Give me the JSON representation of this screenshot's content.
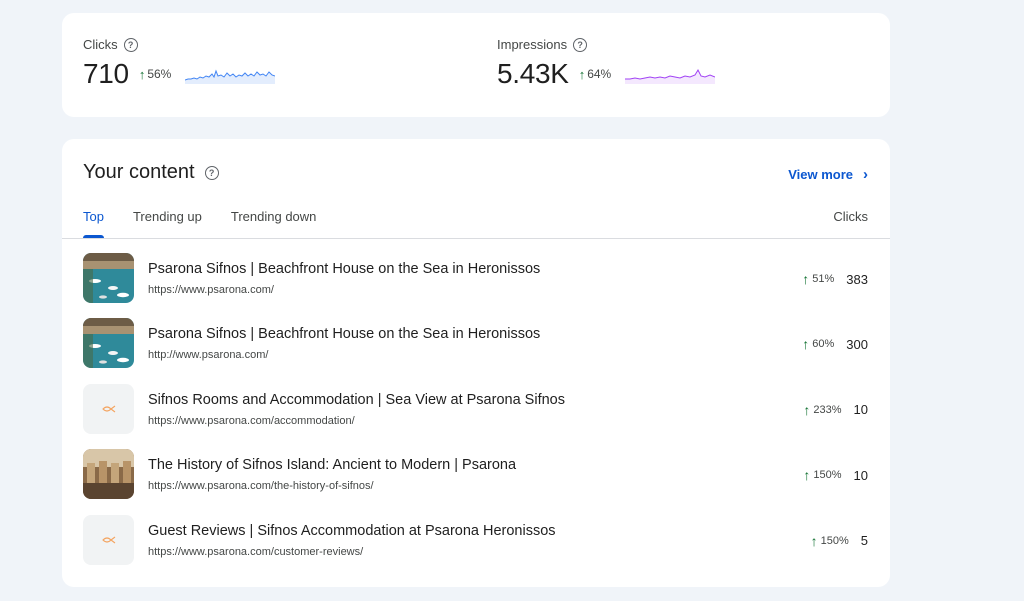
{
  "metrics": {
    "clicks": {
      "label": "Clicks",
      "value": "710",
      "change": "56%",
      "color": "#4285f4"
    },
    "impressions": {
      "label": "Impressions",
      "value": "5.43K",
      "change": "64%",
      "color": "#a142f4"
    }
  },
  "content": {
    "title": "Your content",
    "view_more": "View more",
    "tabs": [
      {
        "label": "Top",
        "active": true
      },
      {
        "label": "Trending up",
        "active": false
      },
      {
        "label": "Trending down",
        "active": false
      }
    ],
    "column_header": "Clicks",
    "rows": [
      {
        "title": "Psarona Sifnos | Beachfront House on the Sea in Heronissos",
        "url": "https://www.psarona.com/",
        "change": "51%",
        "clicks": "383",
        "thumb": "harbor-photo"
      },
      {
        "title": "Psarona Sifnos | Beachfront House on the Sea in Heronissos",
        "url": "http://www.psarona.com/",
        "change": "60%",
        "clicks": "300",
        "thumb": "harbor-photo"
      },
      {
        "title": "Sifnos Rooms and Accommodation | Sea View at Psarona Sifnos",
        "url": "https://www.psarona.com/accommodation/",
        "change": "233%",
        "clicks": "10",
        "thumb": "fish-logo"
      },
      {
        "title": "The History of Sifnos Island: Ancient to Modern | Psarona",
        "url": "https://www.psarona.com/the-history-of-sifnos/",
        "change": "150%",
        "clicks": "10",
        "thumb": "interior-photo"
      },
      {
        "title": "Guest Reviews | Sifnos Accommodation at Psarona Heronissos",
        "url": "https://www.psarona.com/customer-reviews/",
        "change": "150%",
        "clicks": "5",
        "thumb": "fish-logo"
      }
    ]
  },
  "icons": {
    "help": "help-circle-icon",
    "trend": "arrow-up-icon",
    "view_more": "chevron-right-icon"
  }
}
